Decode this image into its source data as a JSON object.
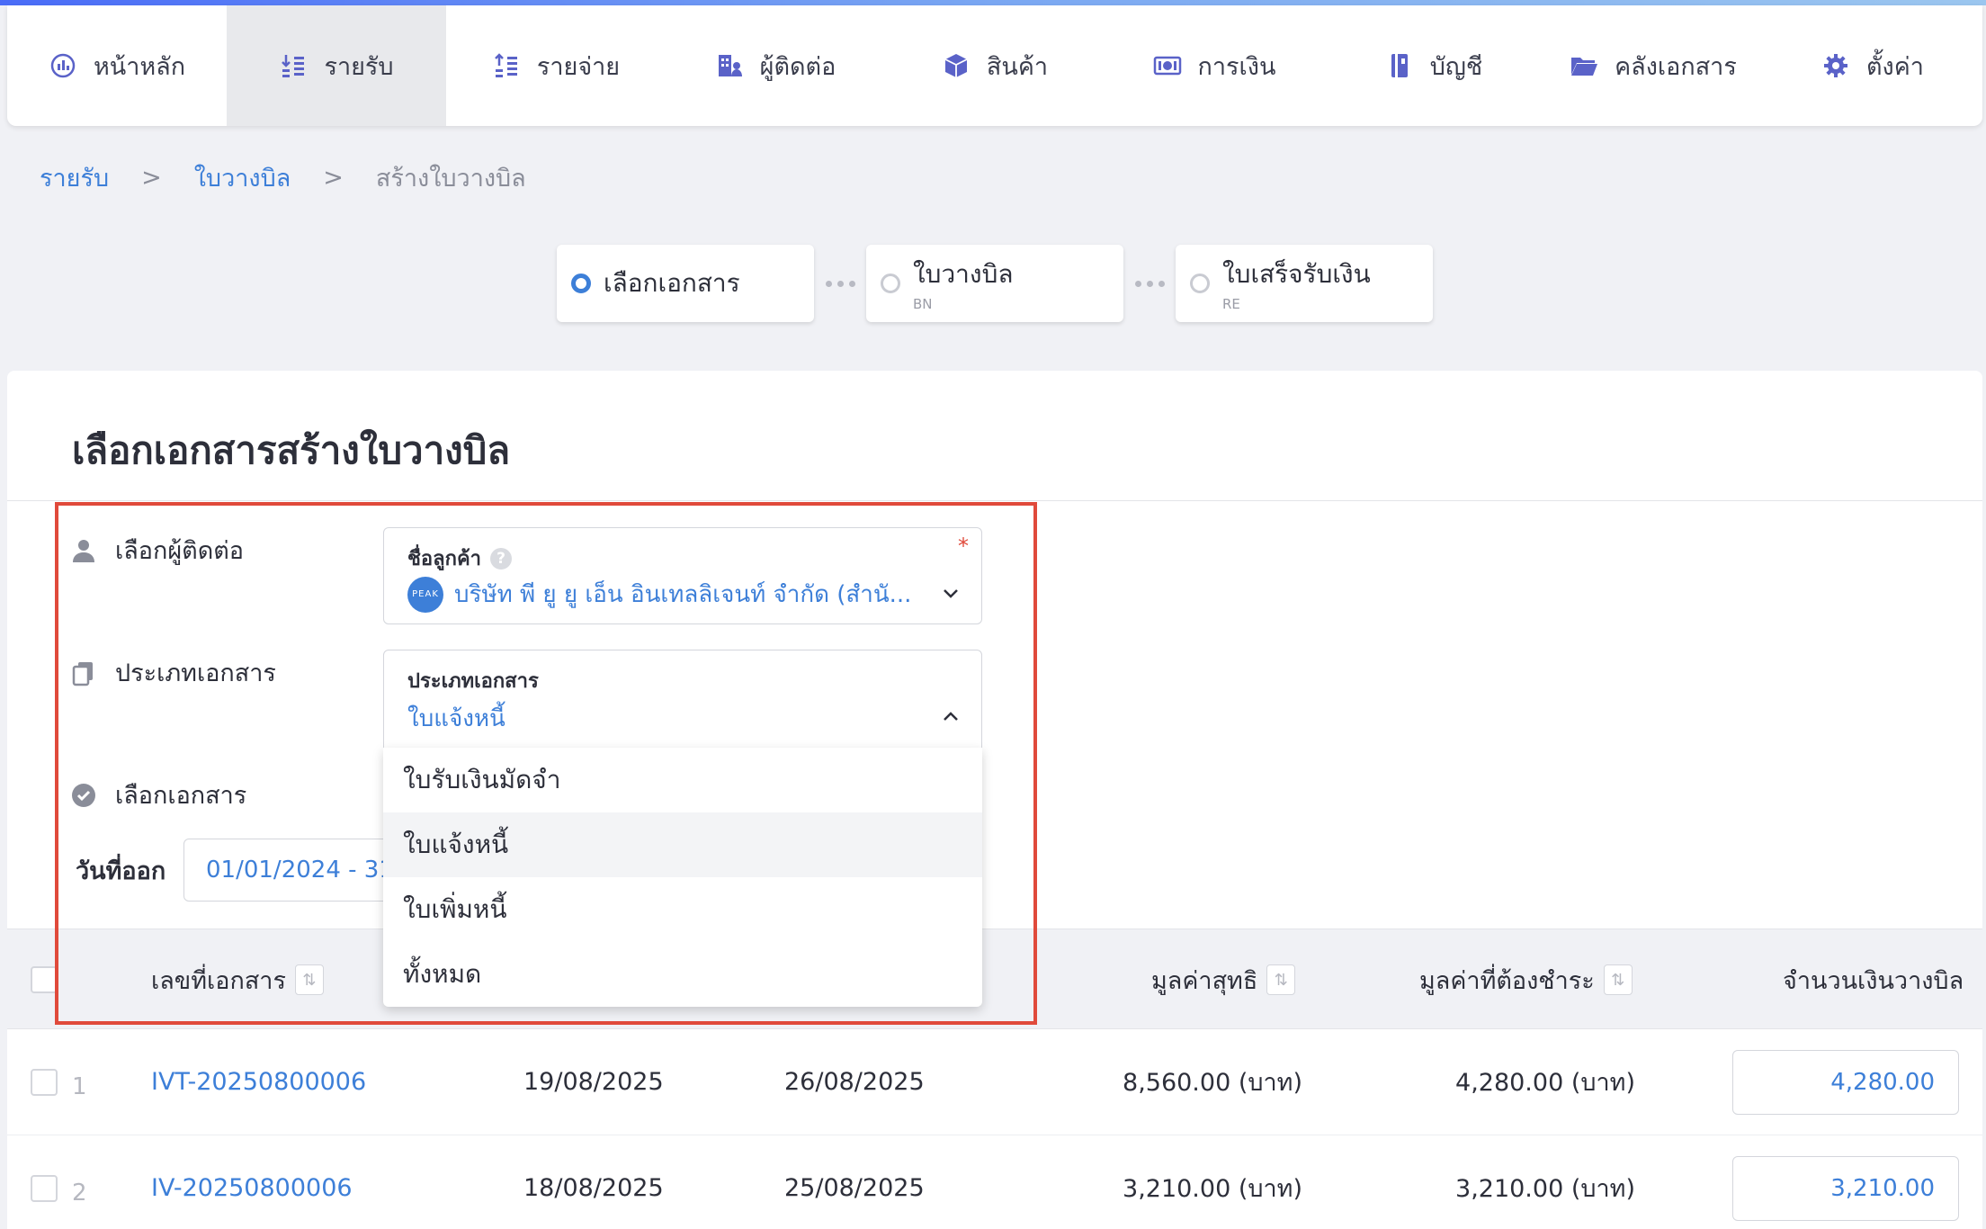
{
  "nav": {
    "items": [
      {
        "label": "หน้าหลัก",
        "icon": "dashboard-icon"
      },
      {
        "label": "รายรับ",
        "icon": "income-icon",
        "active": true
      },
      {
        "label": "รายจ่าย",
        "icon": "expense-icon"
      },
      {
        "label": "ผู้ติดต่อ",
        "icon": "contacts-icon"
      },
      {
        "label": "สินค้า",
        "icon": "box-icon"
      },
      {
        "label": "การเงิน",
        "icon": "money-icon"
      },
      {
        "label": "บัญชี",
        "icon": "ledger-icon"
      },
      {
        "label": "คลังเอกสาร",
        "icon": "folder-icon"
      },
      {
        "label": "ตั้งค่า",
        "icon": "gear-icon"
      }
    ]
  },
  "breadcrumb": {
    "item1": "รายรับ",
    "item2": "ใบวางบิล",
    "current": "สร้างใบวางบิล",
    "separator": ">"
  },
  "steps": [
    {
      "label": "เลือกเอกสาร",
      "sub": "",
      "active": true
    },
    {
      "label": "ใบวางบิล",
      "sub": "BN",
      "active": false
    },
    {
      "label": "ใบเสร็จรับเงิน",
      "sub": "RE",
      "active": false
    }
  ],
  "page": {
    "title": "เลือกเอกสารสร้างใบวางบิล"
  },
  "form": {
    "contact_label": "เลือกผู้ติดต่อ",
    "doc_type_label": "ประเภทเอกสาร",
    "select_doc_label": "เลือกเอกสาร",
    "customer": {
      "caption": "ชื่อลูกค้า",
      "help": "?",
      "required": "*",
      "logo_text": "PEAK",
      "value": "บริษัท พี ยู ยู เอ็น อินเทลลิเจนท์ จำกัด (สำนั..."
    },
    "doc_type": {
      "caption": "ประเภทเอกสาร",
      "value": "ใบแจ้งหนี้"
    },
    "dropdown_options": [
      "ใบรับเงินมัดจำ",
      "ใบแจ้งหนี้",
      "ใบเพิ่มหนี้",
      "ทั้งหมด"
    ],
    "dropdown_selected_index": 1,
    "date": {
      "label": "วันที่ออก",
      "value": "01/01/2024 - 31"
    }
  },
  "table": {
    "headers": {
      "doc_no": "เลขที่เอกสาร",
      "net_value": "มูลค่าสุทธิ",
      "due_value": "มูลค่าที่ต้องชำระ",
      "bill_amount": "จำนวนเงินวางบิล",
      "sort": "⇅"
    },
    "rows": [
      {
        "num": "1",
        "doc_no": "IVT-20250800006",
        "issue_date": "19/08/2025",
        "due_date": "26/08/2025",
        "net_value": "8,560.00 (บาท)",
        "due_value": "4,280.00 (บาท)",
        "bill_amount": "4,280.00"
      },
      {
        "num": "2",
        "doc_no": "IV-20250800006",
        "issue_date": "18/08/2025",
        "due_date": "25/08/2025",
        "net_value": "3,210.00 (บาท)",
        "due_value": "3,210.00 (บาท)",
        "bill_amount": "3,210.00"
      }
    ]
  },
  "colors": {
    "accent": "#3d7fd8",
    "nav_icon": "#5a62c8",
    "highlight": "#e04a3b",
    "page_bg": "#f0f1f5"
  }
}
